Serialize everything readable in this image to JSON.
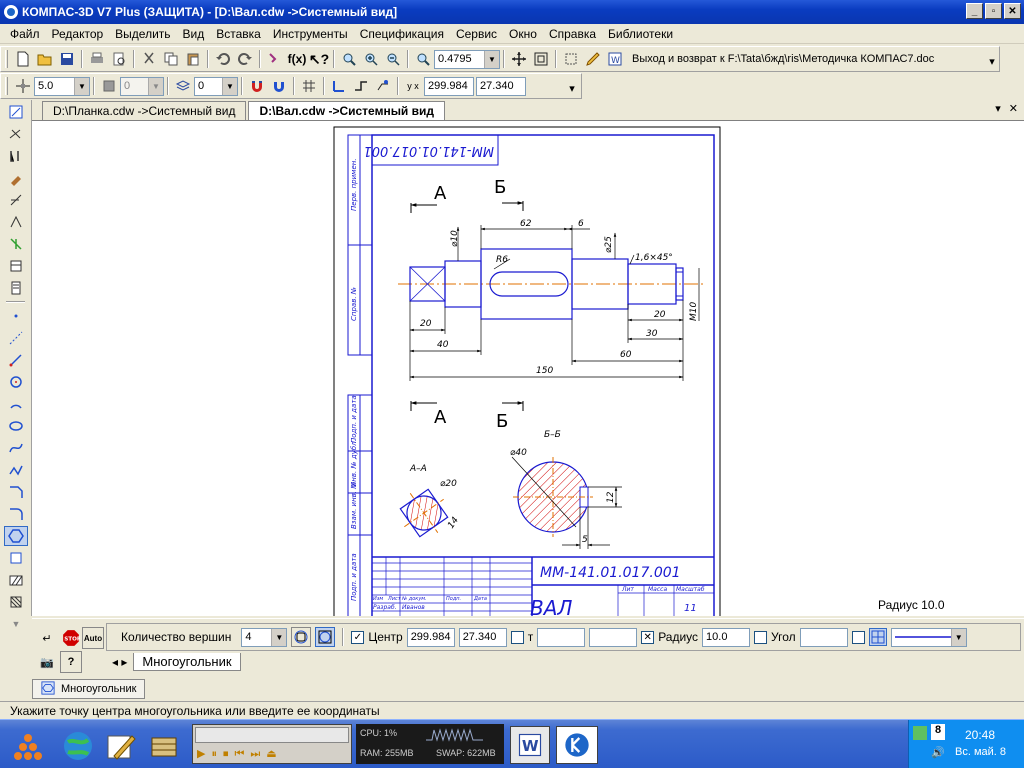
{
  "window": {
    "title": "КОМПАС-3D V7 Plus (ЗАЩИТА) - [D:\\Вал.cdw ->Системный вид]"
  },
  "menu": [
    "Файл",
    "Редактор",
    "Выделить",
    "Вид",
    "Вставка",
    "Инструменты",
    "Спецификация",
    "Сервис",
    "Окно",
    "Справка",
    "Библиотеки"
  ],
  "toolbar": {
    "zoom_value": "0.4795",
    "link_text": "Выход и возврат к F:\\Tata\\бжд\\ris\\Методичка КОМПАС7.doc",
    "step": "5.0",
    "layer_value": "0",
    "style_value": "0",
    "coord_x": "299.984",
    "coord_y": "27.340"
  },
  "tabs": [
    {
      "label": "D:\\Планка.cdw ->Системный вид",
      "active": false
    },
    {
      "label": "D:\\Вал.cdw ->Системный вид",
      "active": true
    }
  ],
  "drawing": {
    "doc_code": "ММ-141.01.017.001",
    "title_name": "ВАЛ",
    "sheet_num": "11",
    "side_labels": [
      "Перв. примен.",
      "Справ. №",
      "Подп. и дата",
      "Инв. № дубл.",
      "Взам. инв. №",
      "Подп. и дата"
    ],
    "tb_headers": [
      "Лит",
      "Масса",
      "Масштаб"
    ],
    "tb_row1": [
      "Изм",
      "Лист",
      "№ докум.",
      "Подп.",
      "Дата"
    ],
    "tb_row2": [
      "Разраб.",
      "Иванов"
    ],
    "dims": {
      "d10": "⌀10",
      "d25": "⌀25",
      "r6": "R6",
      "ch": "1,6×45°",
      "m10": "M10",
      "d62": "62",
      "d6": "6",
      "d20a": "20",
      "d40": "40",
      "d150": "150",
      "d20b": "20",
      "d30": "30",
      "d60": "60",
      "d20s": "⌀20",
      "d40s": "⌀40",
      "d12": "12",
      "d5": "5",
      "d14": "14"
    },
    "view_labels": {
      "a": "А",
      "b": "Б",
      "aa": "А–А",
      "bb": "Б–Б"
    }
  },
  "radius_readout": "Радиус 10.0",
  "property_bar": {
    "vertex_label": "Количество вершин",
    "vertex_value": "4",
    "center_label": "Центр",
    "center_x": "299.984",
    "center_y": "27.340",
    "t_label": "т",
    "radius_label": "Радиус",
    "radius_value": "10.0",
    "angle_label": "Угол",
    "tab_label": "Многоугольник"
  },
  "status_tab": "Многоугольник",
  "hint": "Укажите точку центра многоугольника или введите ее координаты",
  "taskbar": {
    "cpu": "CPU: 1%",
    "ram": "RAM: 255MB",
    "swap": "SWAP: 622MB",
    "lang": "8",
    "time": "20:48",
    "date": "Вс. май. 8"
  },
  "colors": {
    "accent": "#0a3cc0",
    "drawing_blue": "#1a1ad0",
    "axis_orange": "#e07000",
    "hatch_red": "#d00000"
  }
}
